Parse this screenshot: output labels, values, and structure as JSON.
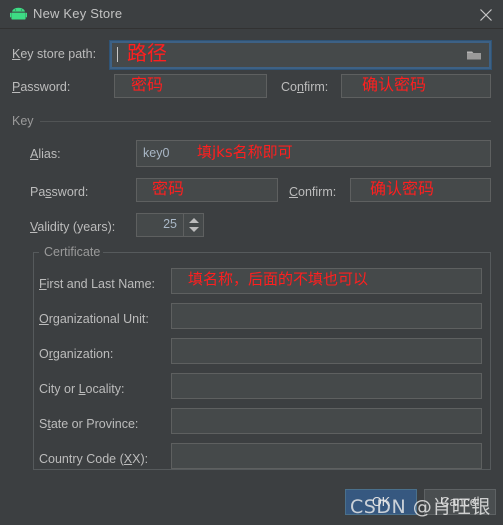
{
  "window": {
    "title": "New Key Store",
    "icon": "android-robot-icon",
    "close_icon": "close-icon",
    "accent_blue": "#365880",
    "focus_border": "#3d6185",
    "annotation_color": "#ff1f1f",
    "background": "#3c3f41",
    "field_background": "#45494a"
  },
  "keystore": {
    "path_label": "Key store path:",
    "path_value": "",
    "path_annotation": "路径",
    "browse_icon": "folder-icon",
    "password_label": "Password:",
    "password_value": "",
    "password_annotation": "密码",
    "confirm_label": "Confirm:",
    "confirm_value": "",
    "confirm_annotation": "确认密码"
  },
  "key": {
    "group_label": "Key",
    "alias_label": "Alias:",
    "alias_value": "key0",
    "alias_annotation": "填jks名称即可",
    "password_label": "Password:",
    "password_value": "",
    "password_annotation": "密码",
    "confirm_label": "Confirm:",
    "confirm_value": "",
    "confirm_annotation": "确认密码",
    "validity_label": "Validity (years):",
    "validity_value": "25"
  },
  "certificate": {
    "group_label": "Certificate",
    "name_annotation": "填名称，后面的不填也可以",
    "fields": [
      {
        "label": "First and Last Name:",
        "value": ""
      },
      {
        "label": "Organizational Unit:",
        "value": ""
      },
      {
        "label": "Organization:",
        "value": ""
      },
      {
        "label": "City or Locality:",
        "value": ""
      },
      {
        "label": "State or Province:",
        "value": ""
      },
      {
        "label": "Country Code (XX):",
        "value": ""
      }
    ]
  },
  "buttons": {
    "ok": "OK",
    "cancel": "Cancel"
  },
  "watermark": {
    "text": "CSDN @肖旺银"
  }
}
